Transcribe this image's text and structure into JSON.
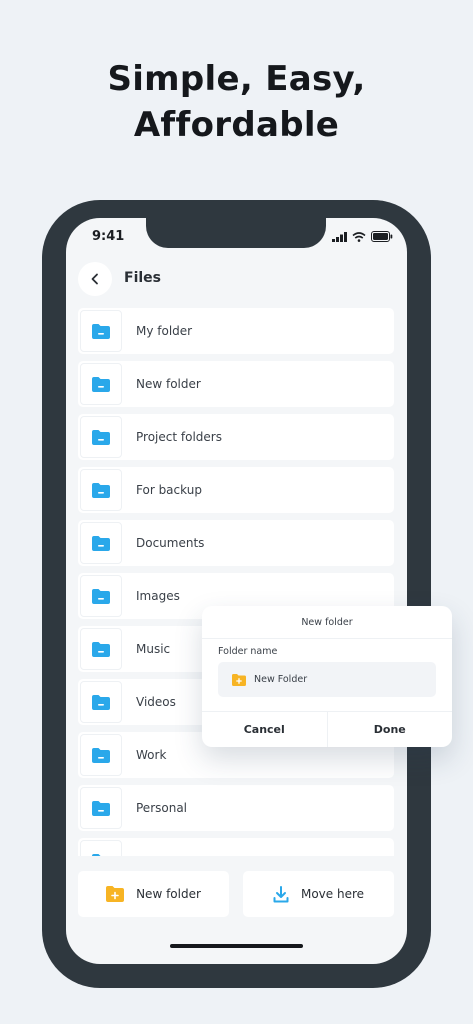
{
  "headline": {
    "line1": "Simple, Easy,",
    "line2": "Affordable"
  },
  "status": {
    "time": "9:41"
  },
  "header": {
    "title": "Files"
  },
  "folders": [
    {
      "label": "My folder"
    },
    {
      "label": "New folder"
    },
    {
      "label": "Project folders"
    },
    {
      "label": "For backup"
    },
    {
      "label": "Documents"
    },
    {
      "label": "Images"
    },
    {
      "label": "Music"
    },
    {
      "label": "Videos"
    },
    {
      "label": "Work"
    },
    {
      "label": "Personal"
    }
  ],
  "bottom": {
    "new_folder": "New folder",
    "move_here": "Move here"
  },
  "dialog": {
    "title": "New folder",
    "field_label": "Folder name",
    "field_value": "New Folder",
    "cancel": "Cancel",
    "done": "Done"
  },
  "colors": {
    "folder_blue": "#2aa8ea",
    "folder_orange": "#f7b424",
    "phone_frame": "#2f383f",
    "background": "#eef2f6"
  },
  "icons": {
    "folder": "folder-icon",
    "back": "chevron-left-icon",
    "new_folder": "folder-plus-icon",
    "move": "download-icon"
  }
}
